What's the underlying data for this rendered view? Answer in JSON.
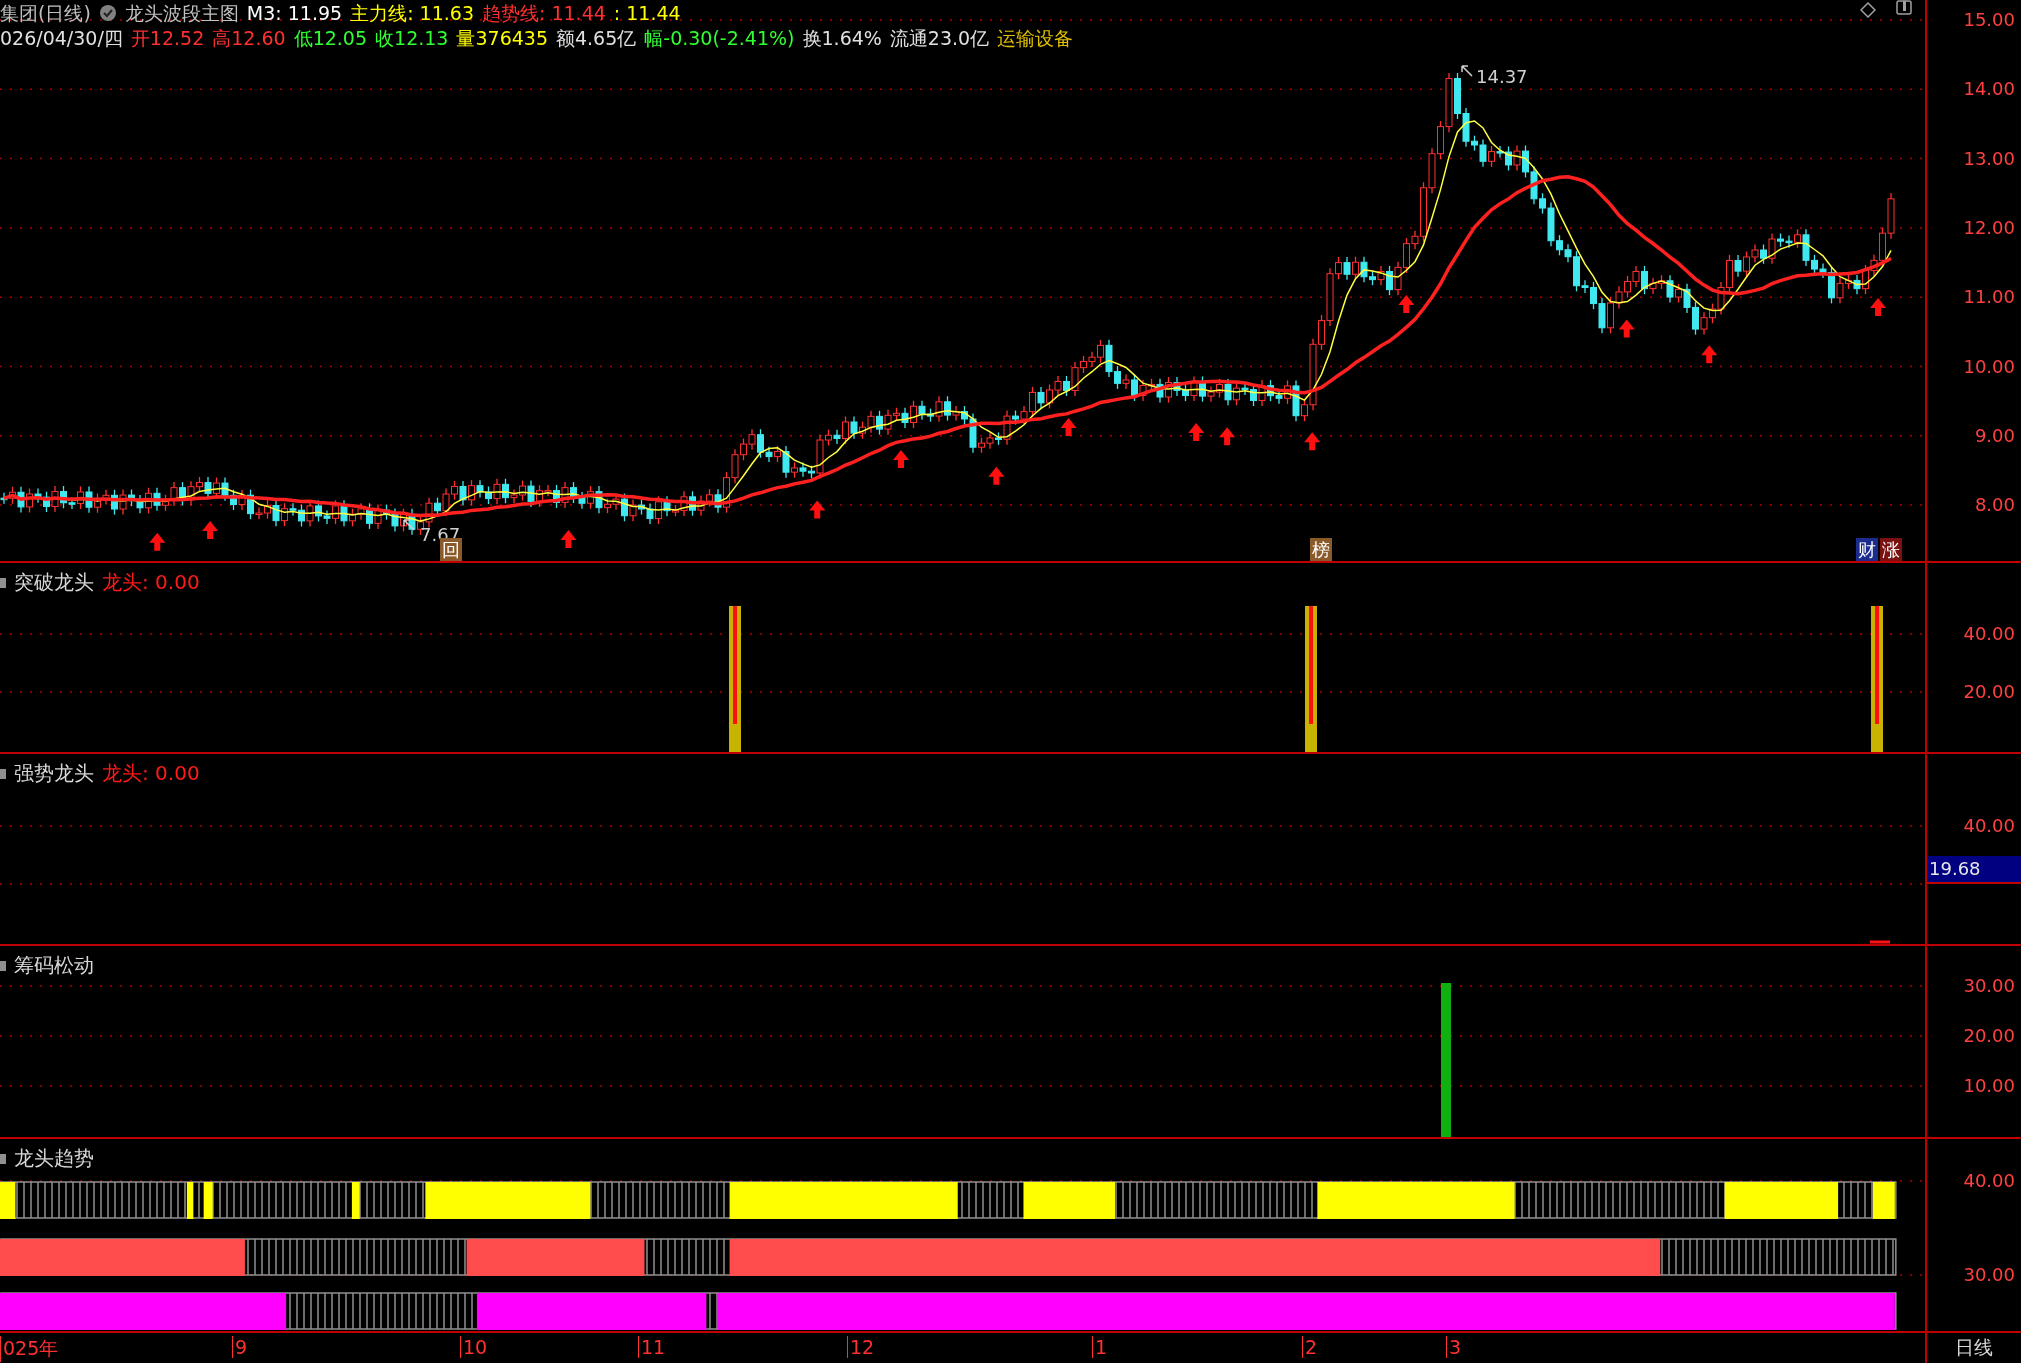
{
  "header": {
    "line1": [
      {
        "text": "集团(日线)",
        "color": "#c0c0c0"
      },
      {
        "text": "龙头波段主图",
        "color": "#c0c0c0"
      },
      {
        "text": "M3: 11.95",
        "color": "#ffffff"
      },
      {
        "text": "主力线: 11.63",
        "color": "#ffff00"
      },
      {
        "text": "趋势线: 11.44",
        "color": "#ff3030"
      },
      {
        "text": ": 11.44",
        "color": "#ffff00"
      }
    ],
    "line2": [
      {
        "text": "026/04/30/四",
        "color": "#e0e0e0"
      },
      {
        "text": "开12.52",
        "color": "#ff3030"
      },
      {
        "text": "高12.60",
        "color": "#ff3030"
      },
      {
        "text": "低12.05",
        "color": "#30ff30"
      },
      {
        "text": "收12.13",
        "color": "#30ff30"
      },
      {
        "text": "量376435",
        "color": "#ffff00"
      },
      {
        "text": "额4.65亿",
        "color": "#e0e0e0"
      },
      {
        "text": "幅-0.30(-2.41%)",
        "color": "#30ff30"
      },
      {
        "text": "换1.64%",
        "color": "#e0e0e0"
      },
      {
        "text": "流通23.0亿",
        "color": "#e0e0e0"
      },
      {
        "text": "运输设备",
        "color": "#e0c000"
      }
    ]
  },
  "main_chart": {
    "ticks": [
      "15.00",
      "14.00",
      "13.00",
      "12.00",
      "11.00",
      "10.00",
      "9.00",
      "8.00"
    ],
    "high_label": "14.37",
    "low_label": "7.67",
    "markers": [
      {
        "text": "回",
        "color": "#8b5a2b"
      },
      {
        "text": "榜",
        "color": "#8b5a2b"
      },
      {
        "text": "财",
        "color": "#1c2c8c"
      },
      {
        "text": "涨",
        "color": "#7a1010"
      }
    ]
  },
  "panels": [
    {
      "title": "突破龙头",
      "value": "龙头: 0.00",
      "ticks": [
        "40.00",
        "20.00"
      ]
    },
    {
      "title": "强势龙头",
      "value": "龙头: 0.00",
      "ticks": [
        "40.00"
      ],
      "cursor_value": "19.68"
    },
    {
      "title": "筹码松动",
      "ticks": [
        "30.00",
        "20.00",
        "10.00"
      ]
    },
    {
      "title": "龙头趋势",
      "ticks": [
        "40.00",
        "30.00"
      ]
    }
  ],
  "date_axis": {
    "labels": [
      "025年",
      "9",
      "10",
      "11",
      "12",
      "1",
      "2",
      "3"
    ],
    "period": "日线"
  }
}
